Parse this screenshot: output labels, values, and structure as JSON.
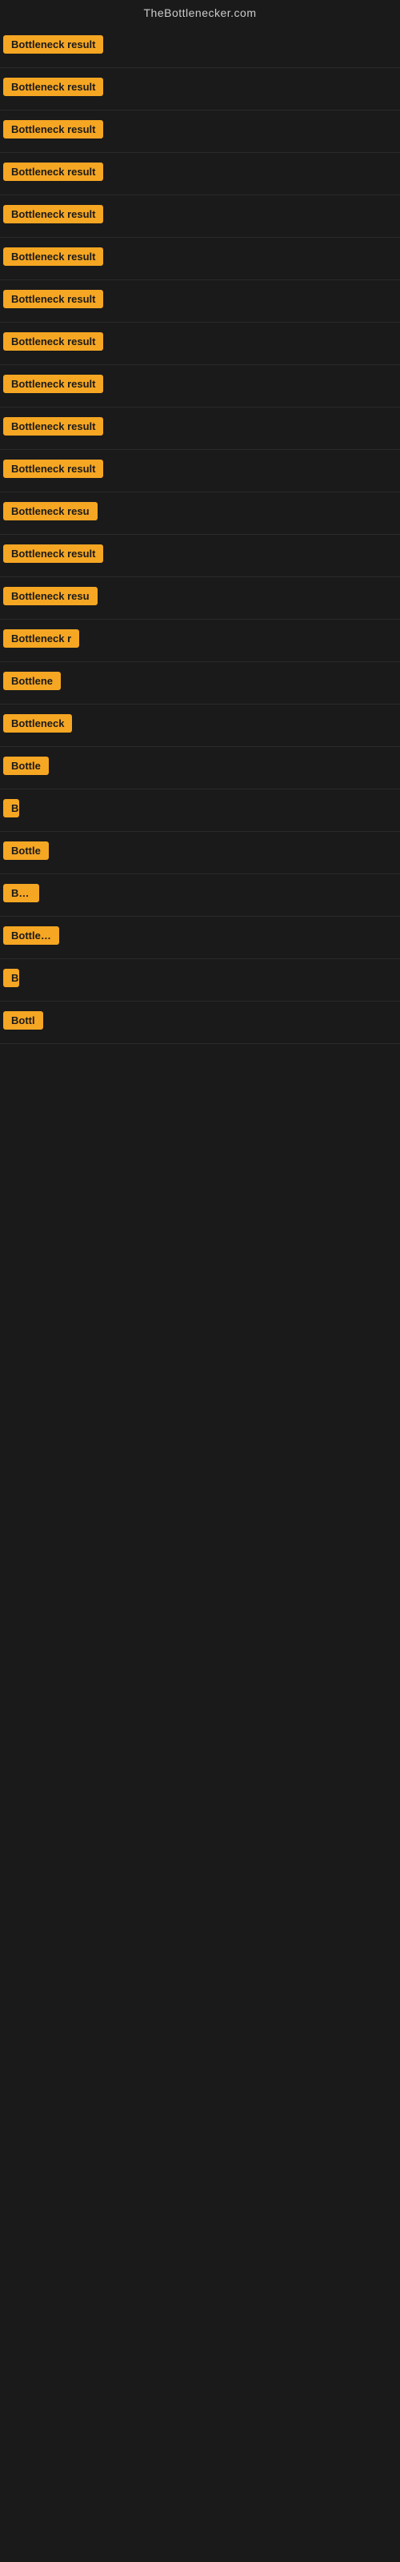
{
  "site": {
    "title": "TheBottlenecker.com"
  },
  "results": [
    {
      "label": "Bottleneck result",
      "width": 160
    },
    {
      "label": "Bottleneck result",
      "width": 155
    },
    {
      "label": "Bottleneck result",
      "width": 160
    },
    {
      "label": "Bottleneck result",
      "width": 155
    },
    {
      "label": "Bottleneck result",
      "width": 160
    },
    {
      "label": "Bottleneck result",
      "width": 157
    },
    {
      "label": "Bottleneck result",
      "width": 160
    },
    {
      "label": "Bottleneck result",
      "width": 157
    },
    {
      "label": "Bottleneck result",
      "width": 160
    },
    {
      "label": "Bottleneck result",
      "width": 155
    },
    {
      "label": "Bottleneck result",
      "width": 157
    },
    {
      "label": "Bottleneck resu",
      "width": 135
    },
    {
      "label": "Bottleneck result",
      "width": 155
    },
    {
      "label": "Bottleneck resu",
      "width": 130
    },
    {
      "label": "Bottleneck r",
      "width": 100
    },
    {
      "label": "Bottlene",
      "width": 80
    },
    {
      "label": "Bottleneck",
      "width": 88
    },
    {
      "label": "Bottle",
      "width": 60
    },
    {
      "label": "B",
      "width": 20
    },
    {
      "label": "Bottle",
      "width": 60
    },
    {
      "label": "Bott",
      "width": 45
    },
    {
      "label": "Bottlens",
      "width": 70
    },
    {
      "label": "B",
      "width": 18
    },
    {
      "label": "Bottl",
      "width": 50
    }
  ]
}
